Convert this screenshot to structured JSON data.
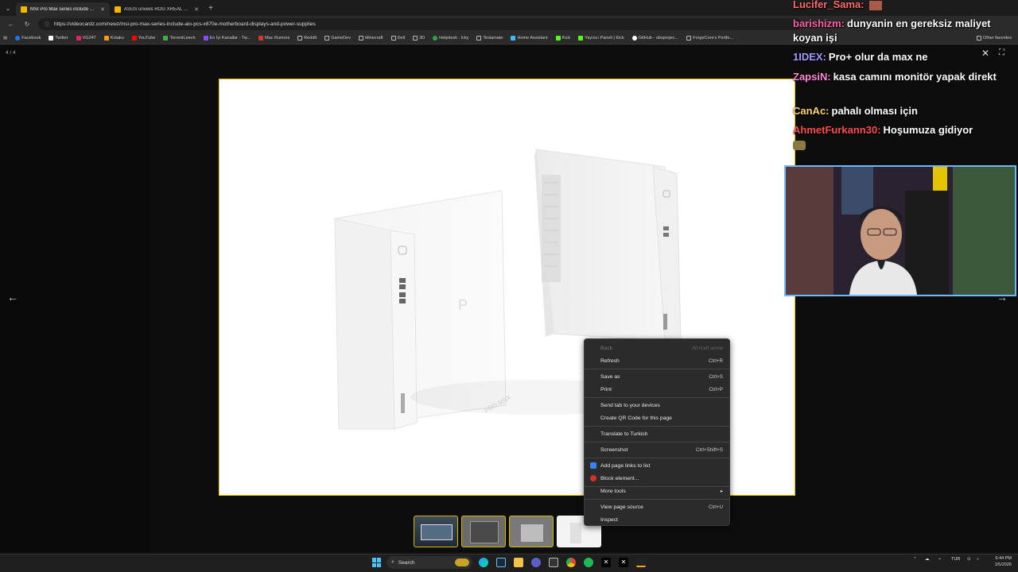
{
  "tabs": [
    {
      "title": "MSI Pro Max series include AIO PC",
      "active": true
    },
    {
      "title": "ASUS unveils ROG XREAL R1 AR g",
      "active": false
    }
  ],
  "address": {
    "url": "https://videocardz.com/newz/msi-pro-max-series-include-aio-pcs-x870e-motherboard-displays-and-power-supplies"
  },
  "bookmarks": [
    {
      "label": "Facebook",
      "color": "#1877f2"
    },
    {
      "label": "Twitter",
      "color": "#ffffff"
    },
    {
      "label": "VG247",
      "color": "#e0245e"
    },
    {
      "label": "Kotaku",
      "color": "#f0a000"
    },
    {
      "label": "YouTube",
      "color": "#ff0000"
    },
    {
      "label": "TorrentLeech",
      "color": "#3cb043"
    },
    {
      "label": "En İyi Kanallar - Tw...",
      "color": "#9146ff"
    },
    {
      "label": "Mac Rumors",
      "color": "#d33"
    },
    {
      "label": "Reddit",
      "color": "#ff4500"
    },
    {
      "label": "GameDev",
      "color": "#aaaaaa"
    },
    {
      "label": "Minecraft",
      "color": "#aaaaaa"
    },
    {
      "label": "Dell",
      "color": "#aaaaaa"
    },
    {
      "label": "3D",
      "color": "#aaaaaa"
    },
    {
      "label": "Helpdesk : Icky",
      "color": "#2ea44f"
    },
    {
      "label": "Teslamate",
      "color": "#aaaaaa"
    },
    {
      "label": "Home Assistant",
      "color": "#41bdf5"
    },
    {
      "label": "Kick",
      "color": "#53fc18"
    },
    {
      "label": "Yayıncı Paneli | Kick",
      "color": "#53fc18"
    },
    {
      "label": "GitHub - obsprojec...",
      "color": "#ffffff"
    },
    {
      "label": "ForgeCore's Portfo...",
      "color": "#aaaaaa"
    }
  ],
  "other_favorites": "Other favorites",
  "lightbox": {
    "counter": "4 / 4"
  },
  "chat": [
    {
      "user": "Lucifer_Sama:",
      "text": "",
      "color": "#ff6b6b"
    },
    {
      "user": "barishizm:",
      "text": "dunyanin en gereksiz maliyet koyan işi",
      "color": "#ff5ea8"
    },
    {
      "user": "1IDEX:",
      "text": "Pro+ olur da max ne",
      "color": "#a59bff"
    },
    {
      "user": "ZapsiN:",
      "text": "kasa camını monitör yapak direkt",
      "color": "#ff8ad8"
    },
    {
      "user": "CanAc:",
      "text": "pahalı olması için",
      "color": "#ffd36b"
    },
    {
      "user": "AhmetFurkann30:",
      "text": "Hoşumuza gidiyor",
      "color": "#ff4d4d"
    }
  ],
  "context_menu": {
    "items": [
      {
        "label": "Back",
        "shortcut": "Alt+Left arrow",
        "disabled": true
      },
      {
        "label": "Refresh",
        "shortcut": "Ctrl+R"
      },
      {
        "label": "Save as",
        "shortcut": "Ctrl+S"
      },
      {
        "label": "Print",
        "shortcut": "Ctrl+P"
      },
      {
        "label": "Send tab to your devices",
        "shortcut": ""
      },
      {
        "label": "Create QR Code for this page",
        "shortcut": ""
      },
      {
        "label": "Translate to Turkish",
        "shortcut": ""
      },
      {
        "label": "Screenshot",
        "shortcut": "Ctrl+Shift+S"
      },
      {
        "label": "Add page links to list",
        "shortcut": "",
        "icon": "link-list-icon",
        "icon_color": "#3b82f6"
      },
      {
        "label": "Block element...",
        "shortcut": "",
        "icon": "adblock-icon",
        "icon_color": "#d32f2f"
      },
      {
        "label": "More tools",
        "shortcut": "▸"
      },
      {
        "label": "View page source",
        "shortcut": "Ctrl+U"
      },
      {
        "label": "Inspect",
        "shortcut": ""
      }
    ]
  },
  "taskbar": {
    "search_placeholder": "Search",
    "language": "TUR",
    "time": "6:44 PM",
    "date": "1/5/2026"
  }
}
